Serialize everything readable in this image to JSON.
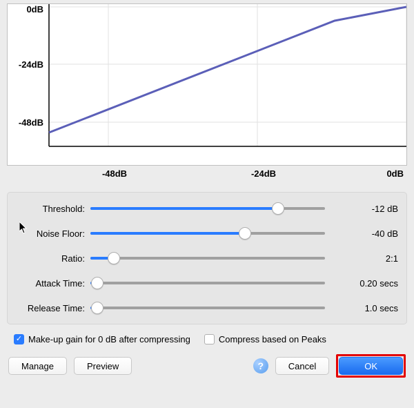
{
  "chart_data": {
    "type": "line",
    "title": "",
    "xlabel": "",
    "ylabel": "",
    "x_ticks": [
      "-48dB",
      "-24dB",
      "0dB"
    ],
    "y_ticks": [
      "0dB",
      "-24dB",
      "-48dB"
    ],
    "xlim": [
      -60,
      0
    ],
    "ylim": [
      -60,
      0
    ],
    "series": [
      {
        "name": "compression-curve",
        "x": [
          -60,
          -12,
          0
        ],
        "y": [
          -54,
          -6,
          0
        ]
      }
    ]
  },
  "sliders": {
    "threshold": {
      "label": "Threshold:",
      "value": "-12 dB",
      "percent": 80
    },
    "noise_floor": {
      "label": "Noise Floor:",
      "value": "-40 dB",
      "percent": 66
    },
    "ratio": {
      "label": "Ratio:",
      "value": "2:1",
      "percent": 10
    },
    "attack_time": {
      "label": "Attack Time:",
      "value": "0.20 secs",
      "percent": 3
    },
    "release_time": {
      "label": "Release Time:",
      "value": "1.0 secs",
      "percent": 3
    }
  },
  "checkboxes": {
    "makeup_gain": {
      "label": "Make-up gain for 0 dB after compressing",
      "checked": true
    },
    "compress_peaks": {
      "label": "Compress based on Peaks",
      "checked": false
    }
  },
  "buttons": {
    "manage": "Manage",
    "preview": "Preview",
    "cancel": "Cancel",
    "ok": "OK"
  },
  "icons": {
    "help": "?"
  }
}
